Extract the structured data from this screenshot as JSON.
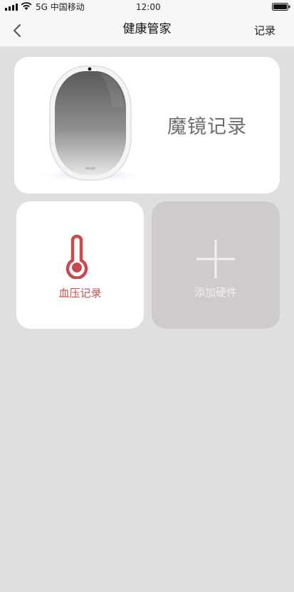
{
  "status_bar": {
    "carrier": "5G 中国移动",
    "time": "12:00",
    "icons": [
      "signal-icon",
      "wifi-icon",
      "battery-icon"
    ]
  },
  "nav": {
    "back_icon": "chevron-left-icon",
    "title": "健康管家",
    "right_action": "记录"
  },
  "cards": {
    "mirror": {
      "label": "魔镜记录",
      "icon": "mirror-icon"
    },
    "blood_pressure": {
      "label": "血压记录",
      "icon": "thermometer-icon",
      "color": "#c94a4e"
    },
    "add_hardware": {
      "label": "添加硬件",
      "icon": "plus-icon"
    }
  },
  "colors": {
    "background": "#dfdfdf",
    "card": "#ffffff",
    "add_card": "#d0cbcb",
    "accent_red": "#c94a4e"
  }
}
